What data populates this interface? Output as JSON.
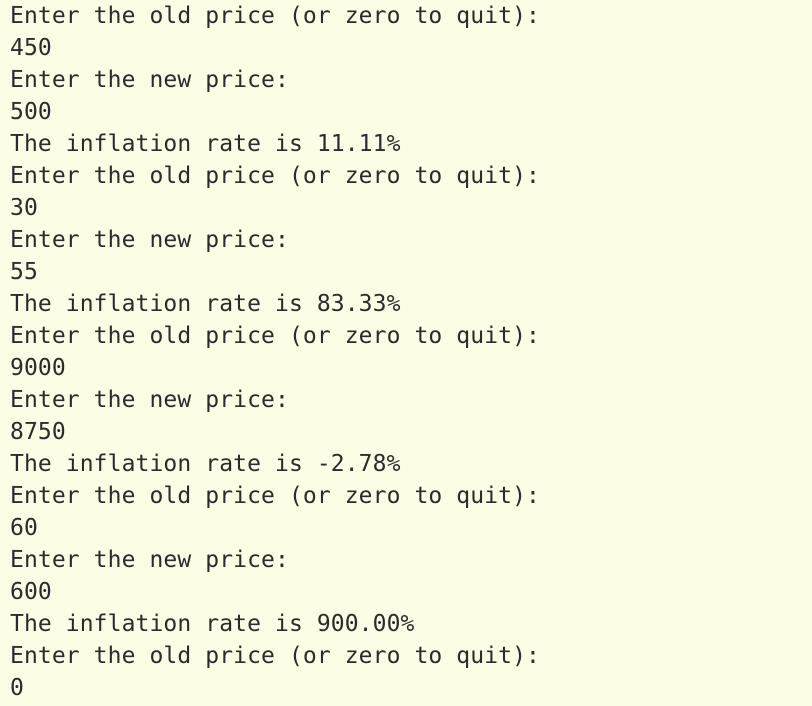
{
  "console": {
    "lines": [
      "Enter the old price (or zero to quit):",
      "450",
      "Enter the new price:",
      "500",
      "The inflation rate is 11.11%",
      "Enter the old price (or zero to quit):",
      "30",
      "Enter the new price:",
      "55",
      "The inflation rate is 83.33%",
      "Enter the old price (or zero to quit):",
      "9000",
      "Enter the new price:",
      "8750",
      "The inflation rate is -2.78%",
      "Enter the old price (or zero to quit):",
      "60",
      "Enter the new price:",
      "600",
      "The inflation rate is 900.00%",
      "Enter the old price (or zero to quit):",
      "0"
    ]
  },
  "colors": {
    "background": "#fdfde5",
    "text": "#2b2b2b"
  }
}
